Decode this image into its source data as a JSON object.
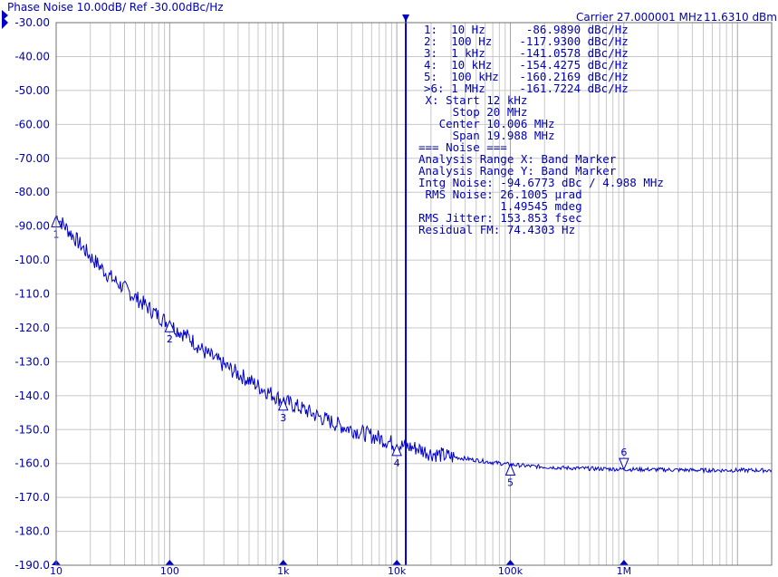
{
  "header": {
    "left_title": "Phase Noise 10.00dB/ Ref -30.00dBc/Hz",
    "carrier": "Carrier 27.000001 MHz",
    "power": "11.6310 dBm"
  },
  "marker_table": [
    "1:  10 Hz      -86.9890 dBc/Hz",
    "2:  100 Hz    -117.9300 dBc/Hz",
    "3:  1 kHz     -141.0578 dBc/Hz",
    "4:  10 kHz    -154.4275 dBc/Hz",
    "5:  100 kHz   -160.2169 dBc/Hz",
    ">6: 1 MHz     -161.7224 dBc/Hz"
  ],
  "analysis_text": [
    " X: Start 12 kHz",
    "     Stop 20 MHz",
    "   Center 10.006 MHz",
    "     Span 19.988 MHz",
    "=== Noise ===",
    "Analysis Range X: Band Marker",
    "Analysis Range Y: Band Marker",
    "Intg Noise: -94.6773 dBc / 4.988 MHz",
    " RMS Noise: 26.1005 µrad",
    "            1.49545 mdeg",
    "RMS Jitter: 153.853 fsec",
    "Residual FM: 74.4303 Hz"
  ],
  "chart_data": {
    "type": "line",
    "x_scale": "log",
    "xlim": [
      10,
      20000000
    ],
    "ylim": [
      -190,
      -30
    ],
    "y_ticks": [
      "-30.00",
      "-40.00",
      "-50.00",
      "-60.00",
      "-70.00",
      "-80.00",
      "-90.00",
      "-100.0",
      "-110.0",
      "-120.0",
      "-130.0",
      "-140.0",
      "-150.0",
      "-160.0",
      "-170.0",
      "-180.0",
      "-190.0"
    ],
    "x_ticks": [
      {
        "value": 10,
        "label": "10"
      },
      {
        "value": 100,
        "label": "100"
      },
      {
        "value": 1000,
        "label": "1k"
      },
      {
        "value": 10000,
        "label": "10k"
      },
      {
        "value": 100000,
        "label": "100k"
      },
      {
        "value": 1000000,
        "label": "1M"
      }
    ],
    "grid": true,
    "series": [
      {
        "x": [
          10,
          15,
          20,
          30,
          50,
          70,
          100,
          150,
          200,
          300,
          500,
          700,
          1000,
          1500,
          2000,
          3000,
          5000,
          7000,
          10000,
          15000,
          20000,
          30000,
          50000,
          70000,
          100000,
          150000,
          200000,
          300000,
          500000,
          700000,
          1000000,
          2000000,
          5000000,
          10000000,
          20000000
        ],
        "y": [
          -87,
          -94,
          -99,
          -105,
          -111,
          -115,
          -119,
          -123,
          -127,
          -131,
          -135.5,
          -138.5,
          -141.5,
          -144,
          -146,
          -148.5,
          -151,
          -152.5,
          -154.5,
          -155.5,
          -157,
          -158,
          -159,
          -159.7,
          -160.3,
          -160.8,
          -161,
          -161.3,
          -161.5,
          -161.6,
          -161.7,
          -161.8,
          -162,
          -162,
          -162
        ]
      }
    ],
    "markers": [
      {
        "label": "1",
        "x": 10,
        "y": -86.989
      },
      {
        "label": "2",
        "x": 100,
        "y": -117.93
      },
      {
        "label": "3",
        "x": 1000,
        "y": -141.0578
      },
      {
        "label": "4",
        "x": 10000,
        "y": -154.4275
      },
      {
        "label": "5",
        "x": 100000,
        "y": -160.2169
      },
      {
        "label": "6",
        "x": 1000000,
        "y": -161.7224
      }
    ],
    "band_marker_x": 12000,
    "colors": {
      "trace": "#0000c8",
      "grid": "#c8c8c8",
      "text": "#0000b4",
      "band": "#0000c8"
    }
  }
}
